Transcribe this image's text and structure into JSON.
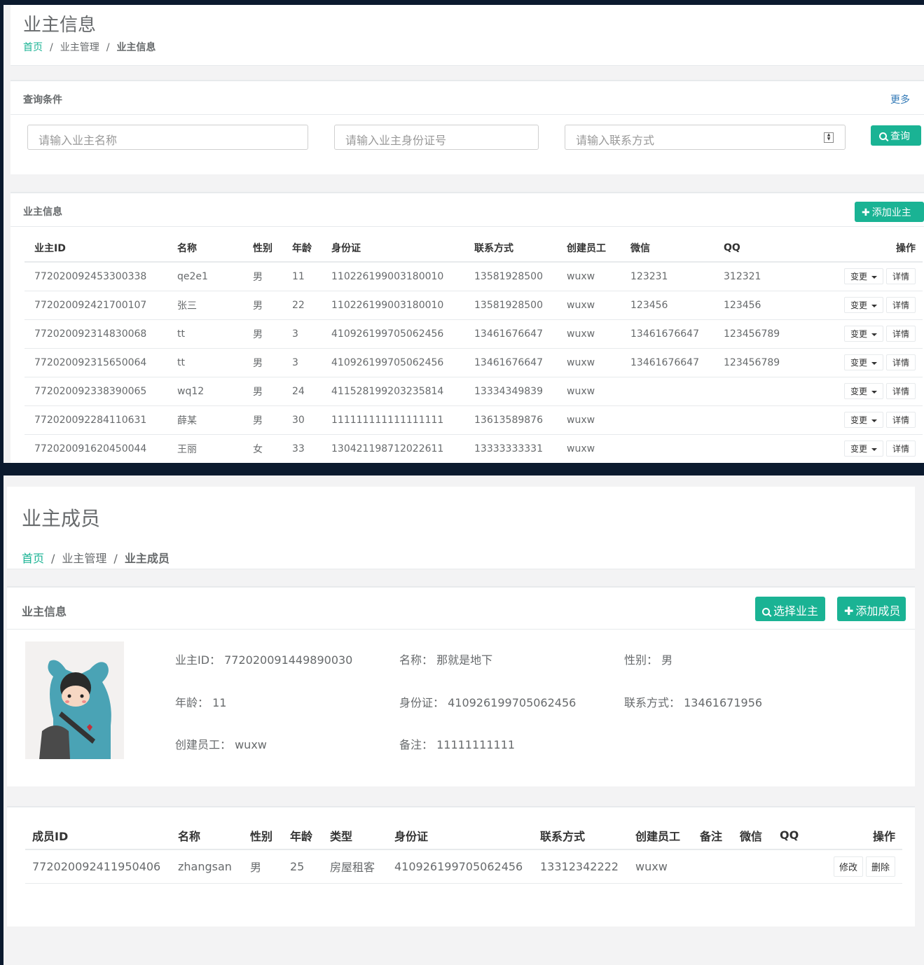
{
  "owner_info_page": {
    "title": "业主信息",
    "breadcrumb": {
      "home": "首页",
      "sep1": "/",
      "level2": "业主管理",
      "sep2": "/",
      "current": "业主信息"
    },
    "query": {
      "title": "查询条件",
      "more": "更多",
      "name_placeholder": "请输入业主名称",
      "id_placeholder": "请输入业主身份证号",
      "phone_placeholder": "请输入联系方式",
      "search_label": "查询"
    },
    "table": {
      "title": "业主信息",
      "add_label": "添加业主",
      "headers": [
        "业主ID",
        "名称",
        "性别",
        "年龄",
        "身份证",
        "联系方式",
        "创建员工",
        "微信",
        "QQ",
        "操作"
      ],
      "change_label": "变更",
      "detail_label": "详情",
      "rows": [
        [
          "772020092453300338",
          "qe2e1",
          "男",
          "11",
          "110226199003180010",
          "13581928500",
          "wuxw",
          "123231",
          "312321"
        ],
        [
          "772020092421700107",
          "张三",
          "男",
          "22",
          "110226199003180010",
          "13581928500",
          "wuxw",
          "123456",
          "123456"
        ],
        [
          "772020092314830068",
          "tt",
          "男",
          "3",
          "410926199705062456",
          "13461676647",
          "wuxw",
          "13461676647",
          "123456789"
        ],
        [
          "772020092315650064",
          "tt",
          "男",
          "3",
          "410926199705062456",
          "13461676647",
          "wuxw",
          "13461676647",
          "123456789"
        ],
        [
          "772020092338390065",
          "wq12",
          "男",
          "24",
          "411528199203235814",
          "13334349839",
          "wuxw",
          "",
          ""
        ],
        [
          "772020092284110631",
          "薛某",
          "男",
          "30",
          "111111111111111111",
          "13613589876",
          "wuxw",
          "",
          ""
        ],
        [
          "772020091620450044",
          "王丽",
          "女",
          "33",
          "130421198712022611",
          "13333333331",
          "wuxw",
          "",
          ""
        ]
      ]
    }
  },
  "owner_member_page": {
    "title": "业主成员",
    "breadcrumb": {
      "home": "首页",
      "sep1": "/",
      "level2": "业主管理",
      "sep2": "/",
      "current": "业主成员"
    },
    "owner_card": {
      "title": "业主信息",
      "select_owner_label": "选择业主",
      "add_member_label": "添加成员",
      "fields": {
        "owner_id": "业主ID：  772020091449890030",
        "name": "名称：  那就是地下",
        "gender": "性别：  男",
        "age": "年龄：  11",
        "id_card": "身份证：  410926199705062456",
        "phone": "联系方式：  13461671956",
        "creator": "创建员工：  wuxw",
        "remark": "备注：  11111111111"
      }
    },
    "members": {
      "headers": [
        "成员ID",
        "名称",
        "性别",
        "年龄",
        "类型",
        "身份证",
        "联系方式",
        "创建员工",
        "备注",
        "微信",
        "QQ",
        "操作"
      ],
      "edit_label": "修改",
      "delete_label": "删除",
      "rows": [
        [
          "772020092411950406",
          "zhangsan",
          "男",
          "25",
          "房屋租客",
          "410926199705062456",
          "13312342222",
          "wuxw",
          "",
          "",
          ""
        ]
      ]
    }
  },
  "colors": {
    "accent": "#1ab394",
    "link": "#337ab7",
    "frame": "#0b1a2e"
  },
  "icons": [
    "search-icon",
    "plus-icon",
    "caret-down-icon",
    "spinner-icon"
  ]
}
